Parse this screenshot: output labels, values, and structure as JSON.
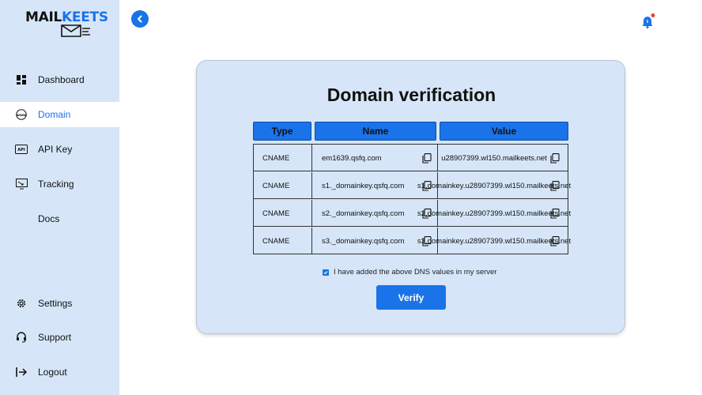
{
  "brand": {
    "logo_part1": "MAIL",
    "logo_part2": "KEETS",
    "accent": "#1a73e8",
    "sidebar_bg": "#d6e6f8"
  },
  "sidebar": {
    "items": [
      {
        "label": "Dashboard",
        "icon": "dashboard-icon"
      },
      {
        "label": "Domain",
        "icon": "www-icon",
        "active": true
      },
      {
        "label": "API Key",
        "icon": "api-icon"
      },
      {
        "label": "Tracking",
        "icon": "tracking-icon"
      },
      {
        "label": "Docs",
        "icon": ""
      },
      {
        "label": "Settings",
        "icon": "gear-icon"
      },
      {
        "label": "Support",
        "icon": "headset-icon"
      },
      {
        "label": "Logout",
        "icon": "logout-icon"
      }
    ]
  },
  "header": {
    "back_icon": "chevron-left-icon",
    "notification_icon": "bell-icon",
    "notification_dot": true
  },
  "card": {
    "title": "Domain verification",
    "columns": [
      "Type",
      "Name",
      "Value"
    ],
    "rows": [
      {
        "type": "CNAME",
        "name": "em1639.qsfq.com",
        "value": "u28907399.wl150.mailkeets.net"
      },
      {
        "type": "CNAME",
        "name": "s1._domainkey.qsfq.com",
        "value": "s1.domainkey.u28907399.wl150.mailkeets.net"
      },
      {
        "type": "CNAME",
        "name": "s2._domainkey.qsfq.com",
        "value": "s2.domainkey.u28907399.wl150.mailkeets.net"
      },
      {
        "type": "CNAME",
        "name": "s3._domainkey.qsfq.com",
        "value": "s3.domainkey.u28907399.wl150.mailkeets.net"
      }
    ],
    "checkbox_label": "I have added the above DNS values in my server",
    "checkbox_checked": true,
    "verify_label": "Verify"
  }
}
